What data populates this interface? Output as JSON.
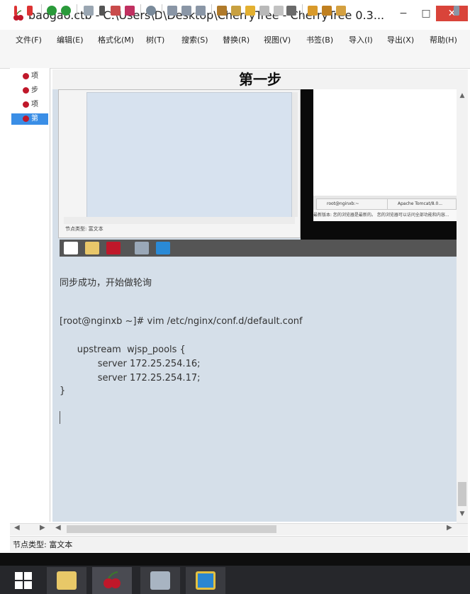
{
  "window": {
    "title": "baogao.ctb - C:\\Users\\D\\Desktop\\CherryTree - CherryTree 0.3...",
    "minimize_glyph": "−",
    "maximize_glyph": "□",
    "close_glyph": "✕"
  },
  "menu": {
    "items": [
      "文件(F)",
      "编辑(E)",
      "格式化(M)",
      "树(T)",
      "搜索(S)",
      "替换(R)",
      "视图(V)",
      "书签(B)",
      "导入(I)",
      "导出(X)",
      "帮助(H)"
    ]
  },
  "tree": {
    "items": [
      {
        "label": "项",
        "selected": false
      },
      {
        "label": "步",
        "selected": false
      },
      {
        "label": "项",
        "selected": false
      },
      {
        "label": "第",
        "selected": true
      }
    ]
  },
  "node": {
    "title": "第一步"
  },
  "embedded": {
    "left_status": "节点类型: 富文本",
    "tab1": "root@nginxb:~",
    "tab2": "Apache Tomcat/8.0...",
    "info_line": "最新版本: 您的浏览器是最新的。 您的浏览器可以访问全部功能和内容..."
  },
  "editor": {
    "lines": [
      "同步成功，开始做轮询",
      "[root@nginxb ~]# vim /etc/nginx/conf.d/default.conf",
      "      upstream  wjsp_pools {",
      "             server 172.25.254.16;",
      "             server 172.25.254.17;",
      "}"
    ]
  },
  "scroll": {
    "up": "▲",
    "down": "▼",
    "left": "◀",
    "right": "▶"
  },
  "status": {
    "text": "节点类型: 富文本"
  },
  "colors": {
    "editor_bg": "#d5dfe9",
    "close_button": "#d9443a",
    "tree_selection": "#3a8ee6",
    "cherry": "#c0182a",
    "taskbar": "#26272b"
  }
}
